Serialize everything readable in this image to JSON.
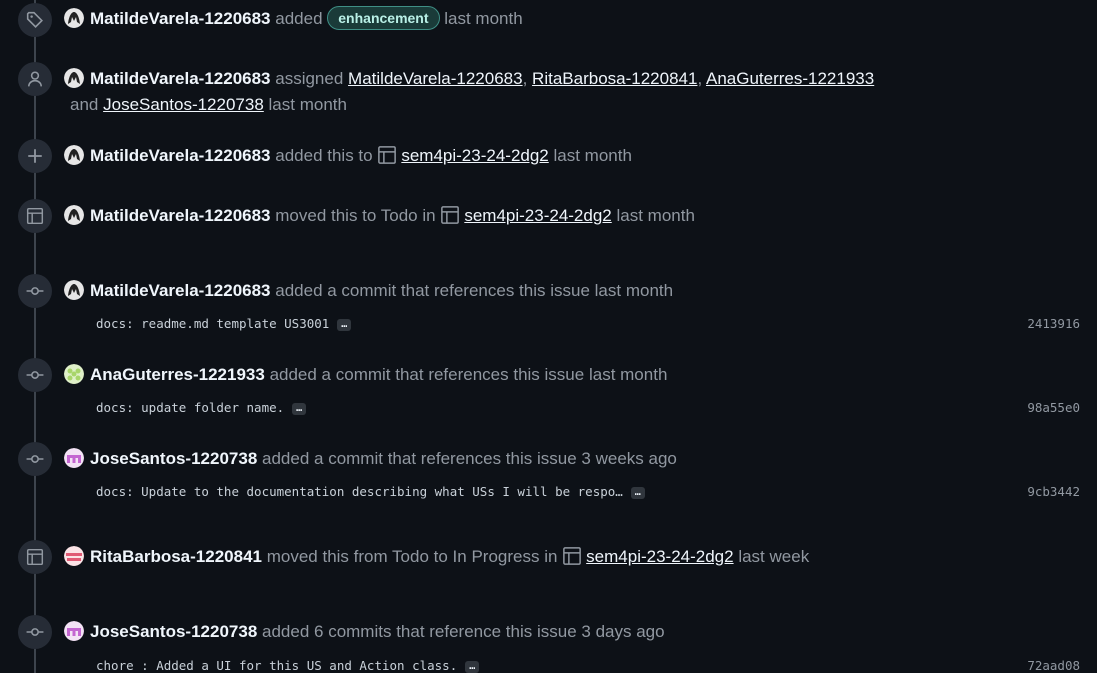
{
  "events": [
    {
      "author": "MatildeVarela-1220683",
      "verb": "added",
      "label": "enhancement",
      "time": "last month"
    },
    {
      "author": "MatildeVarela-1220683",
      "verb": "assigned",
      "assignees": [
        "MatildeVarela-1220683",
        "RitaBarbosa-1220841",
        "AnaGuterres-1221933"
      ],
      "and_text": "and",
      "last_assignee": "JoseSantos-1220738",
      "time": "last month",
      "sep": ","
    },
    {
      "author": "MatildeVarela-1220683",
      "verb": "added this to",
      "project": "sem4pi-23-24-2dg2",
      "time": "last month"
    },
    {
      "author": "MatildeVarela-1220683",
      "verb": "moved this to Todo in",
      "project": "sem4pi-23-24-2dg2",
      "time": "last month"
    },
    {
      "author": "MatildeVarela-1220683",
      "verb": "added a commit that references this issue",
      "time": "last month",
      "commit": "docs: readme.md template US3001",
      "sha": "2413916"
    },
    {
      "author": "AnaGuterres-1221933",
      "verb": "added a commit that references this issue",
      "time": "last month",
      "commit": "docs: update folder name.",
      "sha": "98a55e0"
    },
    {
      "author": "JoseSantos-1220738",
      "verb": "added a commit that references this issue",
      "time": "3 weeks ago",
      "commit": "docs: Update to the documentation describing what USs I will be respo…",
      "sha": "9cb3442"
    },
    {
      "author": "RitaBarbosa-1220841",
      "verb": "moved this from Todo to In Progress in",
      "project": "sem4pi-23-24-2dg2",
      "time": "last week"
    },
    {
      "author": "JoseSantos-1220738",
      "verb": "added 6 commits that reference this issue",
      "time": "3 days ago",
      "commit": "chore : Added a UI for this US and Action class.",
      "sha": "72aad08"
    }
  ],
  "ellipsis": "…",
  "icons": {
    "label": "tag-icon",
    "assign": "person-icon",
    "project_add": "plus-icon",
    "project_move": "table-icon",
    "commit": "git-commit-icon"
  },
  "colors": {
    "background": "#0d1117",
    "label_bg": "#1a3b39",
    "label_border": "#3f8f86",
    "text_muted": "#9198a1",
    "text_strong": "#f0f6fc"
  }
}
